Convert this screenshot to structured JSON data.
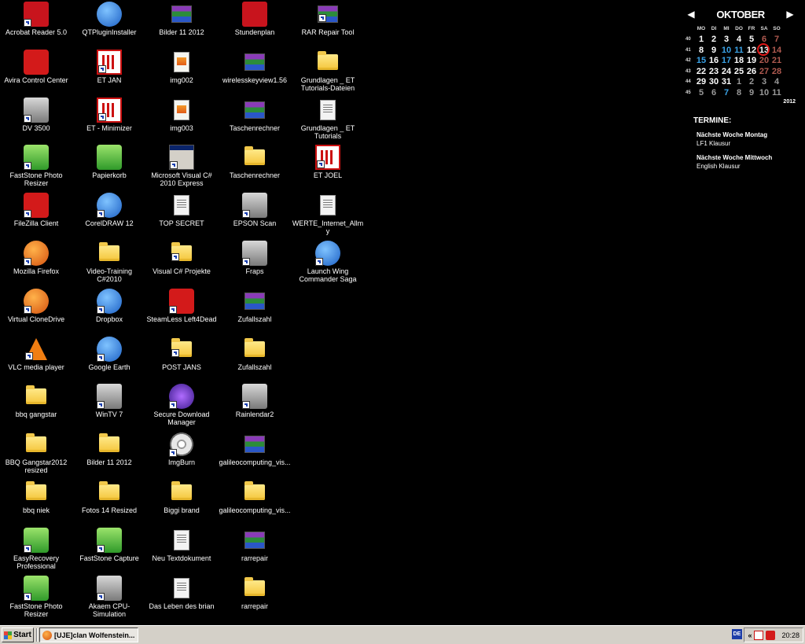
{
  "desktop": {
    "icons": [
      {
        "label": "Acrobat Reader 5.0",
        "icon": "acrobat-icon",
        "style": "s-pdf",
        "shortcut": true
      },
      {
        "label": "Avira Control Center",
        "icon": "avira-icon",
        "style": "s-red",
        "shortcut": false
      },
      {
        "label": "DV 3500",
        "icon": "camera-icon",
        "style": "s-gray",
        "shortcut": true
      },
      {
        "label": "FastStone Photo Resizer",
        "icon": "faststone-resizer-icon",
        "style": "s-green",
        "shortcut": true
      },
      {
        "label": "FileZilla Client",
        "icon": "filezilla-icon",
        "style": "s-red",
        "shortcut": true
      },
      {
        "label": "Mozilla Firefox",
        "icon": "firefox-icon",
        "style": "s-orange",
        "shortcut": true
      },
      {
        "label": "Virtual CloneDrive",
        "icon": "clonedrive-icon",
        "style": "s-orange",
        "shortcut": true
      },
      {
        "label": "VLC media player",
        "icon": "vlc-icon",
        "style": "s-cone",
        "shortcut": true
      },
      {
        "label": "bbq gangstar",
        "icon": "folder-icon",
        "style": "s-folder",
        "shortcut": false
      },
      {
        "label": "BBQ Gangstar2012 resized",
        "icon": "folder-icon",
        "style": "s-folder",
        "shortcut": false
      },
      {
        "label": "bbq niek",
        "icon": "folder-icon",
        "style": "s-folder",
        "shortcut": false
      },
      {
        "label": "EasyRecovery Professional",
        "icon": "easyrecovery-icon",
        "style": "s-green",
        "shortcut": true
      },
      {
        "label": "FastStone Photo Resizer",
        "icon": "faststone-resizer-icon",
        "style": "s-green",
        "shortcut": true
      },
      {
        "label": "QTPluginInstaller",
        "icon": "quicktime-icon",
        "style": "s-blue",
        "shortcut": false
      },
      {
        "label": "ET JAN",
        "icon": "et-icon",
        "style": "s-et",
        "shortcut": true
      },
      {
        "label": "ET - Minimizer",
        "icon": "et-icon",
        "style": "s-et",
        "shortcut": true
      },
      {
        "label": "Papierkorb",
        "icon": "recycle-bin-icon",
        "style": "s-green",
        "shortcut": false
      },
      {
        "label": "CorelDRAW 12",
        "icon": "coreldraw-icon",
        "style": "s-blue",
        "shortcut": true
      },
      {
        "label": "Video-Training C#2010",
        "icon": "folder-icon",
        "style": "s-folder",
        "shortcut": false
      },
      {
        "label": "Dropbox",
        "icon": "dropbox-icon",
        "style": "s-blue",
        "shortcut": true
      },
      {
        "label": "Google Earth",
        "icon": "google-earth-icon",
        "style": "s-blue",
        "shortcut": true
      },
      {
        "label": "WinTV 7",
        "icon": "wintv-icon",
        "style": "s-gray",
        "shortcut": true
      },
      {
        "label": "Bilder 11 2012",
        "icon": "folder-icon",
        "style": "s-folder",
        "shortcut": false
      },
      {
        "label": "Fotos 14 Resized",
        "icon": "folder-icon",
        "style": "s-folder",
        "shortcut": false
      },
      {
        "label": "FastStone Capture",
        "icon": "faststone-capture-icon",
        "style": "s-green",
        "shortcut": true
      },
      {
        "label": "Akaem CPU-Simulation",
        "icon": "flag-icon",
        "style": "s-gray",
        "shortcut": true
      },
      {
        "label": "Bilder 11 2012",
        "icon": "winrar-icon",
        "style": "s-rar",
        "shortcut": false
      },
      {
        "label": "img002",
        "icon": "image-icon",
        "style": "s-img",
        "shortcut": false
      },
      {
        "label": "img003",
        "icon": "image-icon",
        "style": "s-img",
        "shortcut": false
      },
      {
        "label": "Microsoft Visual C# 2010 Express",
        "icon": "visual-studio-icon",
        "style": "s-win",
        "shortcut": true
      },
      {
        "label": "TOP SECRET",
        "icon": "text-file-icon",
        "style": "s-txt",
        "shortcut": false
      },
      {
        "label": "Visual C# Projekte",
        "icon": "folder-icon",
        "style": "s-folder",
        "shortcut": true
      },
      {
        "label": "SteamLess Left4Dead",
        "icon": "left4dead-icon",
        "style": "s-red",
        "shortcut": true
      },
      {
        "label": "POST JANS",
        "icon": "folder-icon",
        "style": "s-folder",
        "shortcut": true
      },
      {
        "label": "Secure Download Manager",
        "icon": "download-manager-icon",
        "style": "s-purple",
        "shortcut": true
      },
      {
        "label": "ImgBurn",
        "icon": "imgburn-icon",
        "style": "s-cd",
        "shortcut": true
      },
      {
        "label": "Biggi brand",
        "icon": "folder-icon",
        "style": "s-folder",
        "shortcut": false
      },
      {
        "label": "Neu Textdokument",
        "icon": "text-file-icon",
        "style": "s-txt",
        "shortcut": false
      },
      {
        "label": "Das Leben des brian",
        "icon": "text-file-icon",
        "style": "s-txt",
        "shortcut": false
      },
      {
        "label": "Stundenplan",
        "icon": "pdf-file-icon",
        "style": "s-pdf",
        "shortcut": false
      },
      {
        "label": "wirelesskeyview1.56",
        "icon": "winrar-icon",
        "style": "s-rar",
        "shortcut": false
      },
      {
        "label": "Taschenrechner",
        "icon": "winrar-icon",
        "style": "s-rar",
        "shortcut": false
      },
      {
        "label": "Taschenrechner",
        "icon": "folder-icon",
        "style": "s-folder",
        "shortcut": false
      },
      {
        "label": "EPSON Scan",
        "icon": "scanner-icon",
        "style": "s-gray",
        "shortcut": true
      },
      {
        "label": "Fraps",
        "icon": "fraps-icon",
        "style": "s-gray",
        "shortcut": true
      },
      {
        "label": "Zufallszahl",
        "icon": "winrar-icon",
        "style": "s-rar",
        "shortcut": false
      },
      {
        "label": "Zufallszahl",
        "icon": "folder-icon",
        "style": "s-folder",
        "shortcut": false
      },
      {
        "label": "Rainlendar2",
        "icon": "rainlendar-icon",
        "style": "s-gray",
        "shortcut": true
      },
      {
        "label": "galileocomputing_vis...",
        "icon": "winrar-icon",
        "style": "s-rar",
        "shortcut": false
      },
      {
        "label": "galileocomputing_vis...",
        "icon": "folder-icon",
        "style": "s-folder",
        "shortcut": false
      },
      {
        "label": "rarrepair",
        "icon": "winrar-icon",
        "style": "s-rar",
        "shortcut": false
      },
      {
        "label": "rarrepair",
        "icon": "folder-icon",
        "style": "s-folder",
        "shortcut": false
      },
      {
        "label": "RAR Repair Tool",
        "icon": "winrar-icon",
        "style": "s-rar",
        "shortcut": true
      },
      {
        "label": "Grundlagen _ ET Tutorials-Dateien",
        "icon": "folder-icon",
        "style": "s-folder",
        "shortcut": false
      },
      {
        "label": "Grundlagen _ ET Tutorials",
        "icon": "web-page-icon",
        "style": "s-txt",
        "shortcut": false
      },
      {
        "label": "ET JOEL",
        "icon": "et-icon",
        "style": "s-et",
        "shortcut": true
      },
      {
        "label": "WERTE_Internet_Allmy",
        "icon": "word-document-icon",
        "style": "s-txt",
        "shortcut": false
      },
      {
        "label": "Launch Wing Commander Saga",
        "icon": "wing-commander-icon",
        "style": "s-blue",
        "shortcut": true
      }
    ]
  },
  "calendar": {
    "month": "OKTOBER",
    "year": "2012",
    "prev": "◀",
    "next": "▶",
    "weekday_headers": [
      "MO",
      "DI",
      "MI",
      "DO",
      "FR",
      "SA",
      "SO"
    ],
    "weeks": [
      {
        "wk": "40",
        "days": [
          [
            "1",
            ""
          ],
          [
            "2",
            ""
          ],
          [
            "3",
            ""
          ],
          [
            "4",
            ""
          ],
          [
            "5",
            ""
          ],
          [
            "6",
            "sat"
          ],
          [
            "7",
            "sun"
          ]
        ]
      },
      {
        "wk": "41",
        "days": [
          [
            "8",
            ""
          ],
          [
            "9",
            ""
          ],
          [
            "10",
            "blue"
          ],
          [
            "11",
            "blue"
          ],
          [
            "12",
            ""
          ],
          [
            "13",
            "today"
          ],
          [
            "14",
            "sun"
          ]
        ]
      },
      {
        "wk": "42",
        "days": [
          [
            "15",
            "blue"
          ],
          [
            "16",
            ""
          ],
          [
            "17",
            "blue"
          ],
          [
            "18",
            ""
          ],
          [
            "19",
            ""
          ],
          [
            "20",
            "sat"
          ],
          [
            "21",
            "sun"
          ]
        ]
      },
      {
        "wk": "43",
        "days": [
          [
            "22",
            ""
          ],
          [
            "23",
            ""
          ],
          [
            "24",
            ""
          ],
          [
            "25",
            ""
          ],
          [
            "26",
            ""
          ],
          [
            "27",
            "sat"
          ],
          [
            "28",
            "sun"
          ]
        ]
      },
      {
        "wk": "44",
        "days": [
          [
            "29",
            ""
          ],
          [
            "30",
            ""
          ],
          [
            "31",
            ""
          ],
          [
            "1",
            "other"
          ],
          [
            "2",
            "other"
          ],
          [
            "3",
            "other"
          ],
          [
            "4",
            "other"
          ]
        ]
      },
      {
        "wk": "45",
        "days": [
          [
            "5",
            "other"
          ],
          [
            "6",
            "other"
          ],
          [
            "7",
            "blue"
          ],
          [
            "8",
            "other"
          ],
          [
            "9",
            "other"
          ],
          [
            "10",
            "other"
          ],
          [
            "11",
            "other"
          ]
        ]
      }
    ]
  },
  "termine": {
    "title": "TERMINE:",
    "items": [
      {
        "when": "Nächste Woche Montag",
        "what": "LF1 Klausur"
      },
      {
        "when": "Nächste Woche Mittwoch",
        "what": "English Klausur"
      }
    ]
  },
  "taskbar": {
    "start_label": "Start",
    "task_label": "[UJE]clan Wolfenstein...",
    "lang": "DE",
    "chevron": "«",
    "clock": "20:28"
  },
  "colors": {
    "desktop_bg": "#000000",
    "taskbar_bg": "#d4d0c8",
    "calendar_weekend": "#b05a50",
    "calendar_highlight": "#3aa2e6",
    "today_ring": "#e01818"
  }
}
